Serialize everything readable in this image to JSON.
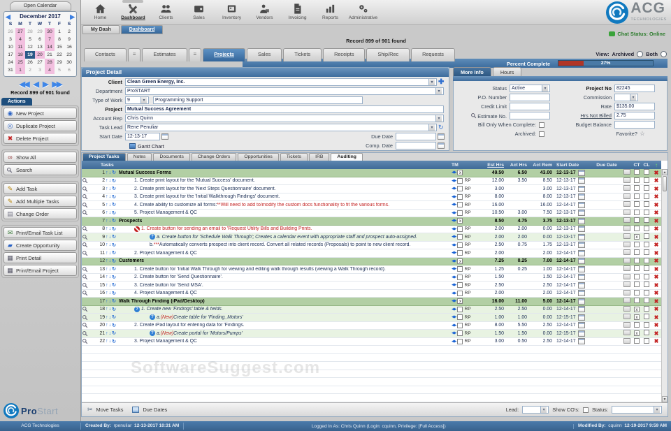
{
  "header": {
    "nav": [
      {
        "label": "Home",
        "icon": "home-icon"
      },
      {
        "label": "Dashboard",
        "icon": "dashboard-icon",
        "active": true
      },
      {
        "label": "Clients",
        "icon": "clients-icon"
      },
      {
        "label": "Sales",
        "icon": "sales-icon"
      },
      {
        "label": "Inventory",
        "icon": "inventory-icon"
      },
      {
        "label": "Vendors",
        "icon": "vendors-icon"
      },
      {
        "label": "Invoicing",
        "icon": "invoicing-icon"
      },
      {
        "label": "Reports",
        "icon": "reports-icon"
      },
      {
        "label": "Administrative",
        "icon": "administrative-icon"
      }
    ],
    "sub_tabs": [
      {
        "label": "My Dash"
      },
      {
        "label": "Dashboard",
        "active": true
      }
    ],
    "record_found": "Record 899 of 901 found",
    "chat_status": "Chat Status: Online",
    "view": {
      "label": "View:",
      "options": [
        "Archived",
        "Both"
      ]
    },
    "logo": {
      "text": "ACG",
      "sub": "TECHNOLOGIES"
    }
  },
  "sidebar": {
    "open_calendar": "Open Calendar",
    "calendar": {
      "title": "December 2017",
      "days": [
        "S",
        "M",
        "T",
        "W",
        "T",
        "F",
        "S"
      ],
      "weeks": [
        [
          [
            26,
            "o"
          ],
          [
            27,
            "p"
          ],
          [
            28,
            "o"
          ],
          [
            29,
            "o"
          ],
          [
            30,
            "p"
          ],
          [
            1,
            ""
          ],
          [
            2,
            ""
          ]
        ],
        [
          [
            3,
            ""
          ],
          [
            4,
            "p"
          ],
          [
            5,
            ""
          ],
          [
            6,
            ""
          ],
          [
            7,
            "p"
          ],
          [
            8,
            ""
          ],
          [
            9,
            ""
          ]
        ],
        [
          [
            10,
            ""
          ],
          [
            11,
            "p"
          ],
          [
            12,
            ""
          ],
          [
            13,
            ""
          ],
          [
            14,
            "p"
          ],
          [
            15,
            ""
          ],
          [
            16,
            ""
          ]
        ],
        [
          [
            17,
            ""
          ],
          [
            18,
            "p"
          ],
          [
            19,
            "s"
          ],
          [
            20,
            "p"
          ],
          [
            21,
            ""
          ],
          [
            22,
            ""
          ],
          [
            23,
            ""
          ]
        ],
        [
          [
            24,
            ""
          ],
          [
            25,
            "p"
          ],
          [
            26,
            ""
          ],
          [
            27,
            ""
          ],
          [
            28,
            "p"
          ],
          [
            29,
            ""
          ],
          [
            30,
            ""
          ]
        ],
        [
          [
            31,
            ""
          ],
          [
            1,
            "p"
          ],
          [
            2,
            "o"
          ],
          [
            3,
            "o"
          ],
          [
            4,
            "p"
          ],
          [
            5,
            "o"
          ],
          [
            6,
            "o"
          ]
        ]
      ]
    },
    "record_label": "Record 899 of 901 found",
    "actions_label": "Actions",
    "action_groups": [
      [
        {
          "label": "New Project",
          "icon": "new-project-icon"
        },
        {
          "label": "Duplicate Project",
          "icon": "duplicate-project-icon"
        },
        {
          "label": "Delete Project",
          "icon": "delete-project-icon"
        }
      ],
      [
        {
          "label": "Show All",
          "icon": "show-all-icon"
        },
        {
          "label": "Search",
          "icon": "search-icon"
        }
      ],
      [
        {
          "label": "Add Task",
          "icon": "add-task-icon"
        },
        {
          "label": "Add Multiple Tasks",
          "icon": "add-multiple-tasks-icon"
        },
        {
          "label": "Change Order",
          "icon": "change-order-icon"
        }
      ],
      [
        {
          "label": "Print/Email Task List",
          "icon": "print-email-task-list-icon"
        },
        {
          "label": "Create Opportunity",
          "icon": "create-opportunity-icon"
        },
        {
          "label": "Print Detail",
          "icon": "print-detail-icon"
        },
        {
          "label": "Print/Email Project",
          "icon": "print-email-project-icon"
        }
      ]
    ],
    "logo_brand": {
      "part1": "Pro",
      "part2": "Start"
    }
  },
  "content_tabs": [
    {
      "label": "Contacts"
    },
    {
      "grip": true
    },
    {
      "label": "Estimates"
    },
    {
      "grip": true
    },
    {
      "label": "Projects",
      "active": true
    },
    {
      "label": "Sales"
    },
    {
      "label": "Tickets"
    },
    {
      "label": "Receipts"
    },
    {
      "label": "Ship/Rec"
    },
    {
      "label": "Requests"
    }
  ],
  "percent": {
    "label": "Percent Complete",
    "value": "27%",
    "pct": 27
  },
  "project_detail": {
    "title": "Project Detail",
    "client_label": "Client",
    "client": "Clean Green Energy, Inc.",
    "department_label": "Department",
    "department": "ProSTART",
    "type_label": "Type of Work",
    "type_code": "9",
    "type_value": "Programming Support",
    "project_label": "Project",
    "project": "Mutual Success Agreement",
    "account_rep_label": "Account Rep",
    "account_rep": "Chris Quinn",
    "task_lead_label": "Task Lead",
    "task_lead": "Rene Penuliar",
    "start_label": "Start Date",
    "start_date": "12-13-17",
    "gantt": "Gantt Chart",
    "due_label": "Due Date",
    "due_date": "",
    "comp_label": "Comp. Date",
    "comp_date": ""
  },
  "more_info": {
    "tab_more": "More Info",
    "tab_hours": "Hours",
    "status_label": "Status",
    "status": "Active",
    "po_label": "P.O. Number",
    "po": "",
    "credit_label": "Credit Limit",
    "credit": "",
    "estimate_label": "Estimate No.",
    "estimate": "",
    "bill_label": "Bill Only When Complete:",
    "archived_label": "Archived:",
    "project_no_label": "Project No",
    "project_no": "82245",
    "commission_label": "Commission",
    "commission": "",
    "rate_label": "Rate",
    "rate": "$135.00",
    "hrs_label": "Hrs Not Billed",
    "hrs": "2.75",
    "budget_label": "Budget Balance",
    "budget": "",
    "favorite_label": "Favorite?"
  },
  "tasks": {
    "tabs": [
      {
        "label": "Project Tasks",
        "active": true
      },
      {
        "label": "Notes"
      },
      {
        "label": "Documents"
      },
      {
        "label": "Change Orders"
      },
      {
        "label": "Opportunities"
      },
      {
        "label": "Tickets"
      },
      {
        "label": "IRB"
      },
      {
        "label": "Auditing",
        "white": true
      }
    ],
    "header": {
      "tasks": "Tasks",
      "tm": "TM",
      "est": "Est Hrs",
      "act": "Act Hrs",
      "rem": "Act Rem",
      "start": "Start Date",
      "due": "Due Date",
      "ct": "CT",
      "cl": "CL"
    },
    "rows": [
      {
        "n": 1,
        "g": 1,
        "seg": [
          {
            "t": "Mutual Success Forms"
          }
        ],
        "est": "49.50",
        "act": "6.50",
        "rem": "43.00",
        "sd": "12-13-17"
      },
      {
        "n": 2,
        "i": 1,
        "tm": "RP",
        "seg": [
          {
            "t": "1. Create print layout for the 'Mutual Success' document."
          }
        ],
        "est": "12.00",
        "act": "3.50",
        "rem": "8.50",
        "sd": "12-13-17"
      },
      {
        "n": 3,
        "i": 1,
        "tm": "RP",
        "seg": [
          {
            "t": "2. Create print layout for the 'Next Steps Questionnaire' document."
          }
        ],
        "est": "3.00",
        "act": "",
        "rem": "3.00",
        "sd": "12-13-17"
      },
      {
        "n": 4,
        "i": 1,
        "tm": "RP",
        "seg": [
          {
            "t": "3. Create print layout for the 'Initial Walkthrough Findings' document."
          }
        ],
        "est": "8.00",
        "act": "",
        "rem": "8.00",
        "sd": "12-13-17"
      },
      {
        "n": 5,
        "i": 1,
        "tm": "RP",
        "seg": [
          {
            "t": "4. Create ability to customize all forms: "
          },
          {
            "t": "**Will need to add to/modify the custom docs functionality to fit the various forms.",
            "c": "r"
          }
        ],
        "est": "16.00",
        "act": "",
        "rem": "16.00",
        "sd": "12-14-17"
      },
      {
        "n": 6,
        "i": 1,
        "tm": "RP",
        "seg": [
          {
            "t": "5. Project Management & QC"
          }
        ],
        "est": "10.50",
        "act": "3.00",
        "rem": "7.50",
        "sd": "12-13-17"
      },
      {
        "n": 7,
        "g": 1,
        "seg": [
          {
            "t": "Prospects"
          }
        ],
        "est": "8.50",
        "act": "4.75",
        "rem": "3.75",
        "sd": "12-13-17"
      },
      {
        "n": 8,
        "i": 1,
        "tm": "RP",
        "ic": "cancel",
        "seg": [
          {
            "t": "1. Create button for sending an email to 'Request Utility Bills and Building Prints.",
            "c": "r"
          }
        ],
        "est": "2.00",
        "act": "2.00",
        "rem": "0.00",
        "sd": "12-13-17"
      },
      {
        "n": 9,
        "i": 2,
        "tm": "RP",
        "ic": "question",
        "it": 1,
        "tn": 1,
        "ct": 1,
        "seg": [
          {
            "t": "a. Create button for 'Schedule Walk Through'; Creates a calendar event with appropriate staff and prospect auto-assigned."
          }
        ],
        "est": "2.00",
        "act": "2.00",
        "rem": "0.00",
        "sd": "12-13-17"
      },
      {
        "n": 10,
        "i": 2,
        "tm": "RP",
        "seg": [
          {
            "t": "b. "
          },
          {
            "t": "***",
            "c": "r"
          },
          {
            "t": "Automatically converts prospect into client record. Convert all related records (Proposals) to point to new client record."
          }
        ],
        "est": "2.50",
        "act": "0.75",
        "rem": "1.75",
        "sd": "12-13-17"
      },
      {
        "n": 11,
        "i": 1,
        "tm": "RP",
        "seg": [
          {
            "t": "2. Project Management & QC"
          }
        ],
        "est": "2.00",
        "act": "",
        "rem": "2.00",
        "sd": "12-14-17"
      },
      {
        "n": 12,
        "g": 1,
        "seg": [
          {
            "t": "Customers"
          }
        ],
        "est": "7.25",
        "act": "0.25",
        "rem": "7.00",
        "sd": "12-14-17"
      },
      {
        "n": 13,
        "i": 1,
        "tm": "RP",
        "seg": [
          {
            "t": "1. Create button for 'Initial Walk Through for viewing and editing walk through results (viewing a Walk Through record)."
          }
        ],
        "est": "1.25",
        "act": "0.25",
        "rem": "1.00",
        "sd": "12-14-17"
      },
      {
        "n": 14,
        "i": 1,
        "tm": "RP",
        "seg": [
          {
            "t": "2. Create button for 'Send Questionnaire'."
          }
        ],
        "est": "1.50",
        "act": "",
        "rem": "1.50",
        "sd": "12-14-17"
      },
      {
        "n": 15,
        "i": 1,
        "tm": "RP",
        "seg": [
          {
            "t": "3. Create button for 'Send MSA'."
          }
        ],
        "est": "2.50",
        "act": "",
        "rem": "2.50",
        "sd": "12-14-17"
      },
      {
        "n": 16,
        "i": 1,
        "tm": "RP",
        "seg": [
          {
            "t": "4. Project Management & QC"
          }
        ],
        "est": "2.00",
        "act": "",
        "rem": "2.00",
        "sd": "12-14-17"
      },
      {
        "n": 17,
        "g": 1,
        "seg": [
          {
            "t": "Walk Through Finding (iPad/Desktop)"
          }
        ],
        "est": "16.00",
        "act": "11.00",
        "rem": "5.00",
        "sd": "12-14-17"
      },
      {
        "n": 18,
        "i": 1,
        "tm": "RP",
        "ic": "question",
        "it": 1,
        "tn": 1,
        "ct": 1,
        "seg": [
          {
            "t": "1. Create new 'Findings' table & fields."
          }
        ],
        "est": "2.50",
        "act": "2.50",
        "rem": "0.00",
        "sd": "12-14-17"
      },
      {
        "n": 19,
        "i": 2,
        "tm": "RP",
        "ic": "question",
        "it": 1,
        "tn": 1,
        "ct": 1,
        "seg": [
          {
            "t": "a. "
          },
          {
            "t": "(New)",
            "c": "r"
          },
          {
            "t": " Create table for 'Finding_Motors'"
          }
        ],
        "est": "1.00",
        "act": "1.00",
        "rem": "0.00",
        "sd": "12-15-17"
      },
      {
        "n": 20,
        "i": 1,
        "tm": "RP",
        "seg": [
          {
            "t": "2. Create iPad layout for entering data for 'Findings."
          }
        ],
        "est": "8.00",
        "act": "5.50",
        "rem": "2.50",
        "sd": "12-14-17"
      },
      {
        "n": 21,
        "i": 2,
        "tm": "RP",
        "ic": "question",
        "it": 1,
        "tn": 1,
        "ct": 1,
        "seg": [
          {
            "t": "a. "
          },
          {
            "t": "(New)",
            "c": "r"
          },
          {
            "t": " Create portal for 'Motors/Pumps'"
          }
        ],
        "est": "1.50",
        "act": "1.50",
        "rem": "0.00",
        "sd": "12-15-17"
      },
      {
        "n": 22,
        "i": 1,
        "tm": "RP",
        "seg": [
          {
            "t": "3. Project Management & QC"
          }
        ],
        "est": "3.00",
        "act": "0.50",
        "rem": "2.50",
        "sd": "12-14-17"
      }
    ],
    "footer": {
      "move": "Move Tasks",
      "due": "Due Dates",
      "lead": "Lead:",
      "show_cos": "Show CO's:",
      "status": "Status:"
    }
  },
  "watermark": {
    "text": "SoftwareSuggest",
    "suffix": ".com"
  },
  "status_bar": {
    "company": "ACG Technologies",
    "created_label": "Created By:",
    "created_user": "rpenuliar",
    "created_date": "12-13-2017 10:31 AM",
    "logged_in": "Logged In As: Chris Quinn (Login: cquinn, Privilege: [Full Access])",
    "modified_label": "Modified By:",
    "modified_user": "cquinn",
    "modified_date": "12-19-2017 9:59 AM"
  }
}
